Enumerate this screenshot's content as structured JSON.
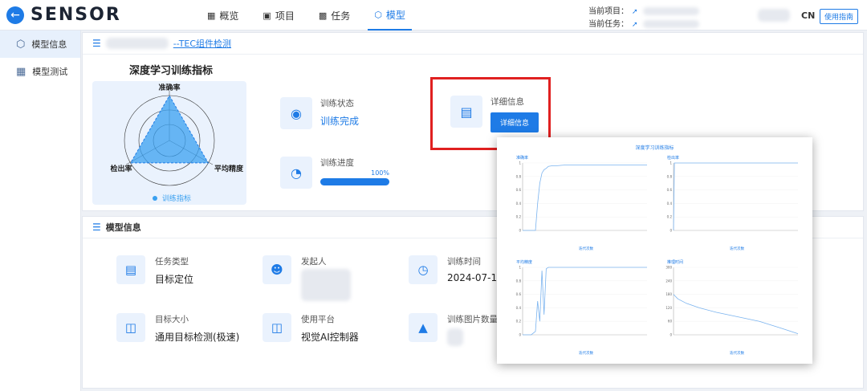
{
  "topbar": {
    "logo": "SENSOR",
    "nav": [
      {
        "label": "概览",
        "icon": "grid-icon"
      },
      {
        "label": "项目",
        "icon": "folder-icon"
      },
      {
        "label": "任务",
        "icon": "image-icon"
      },
      {
        "label": "模型",
        "icon": "cube-icon",
        "active": true
      }
    ],
    "current_project_label": "当前项目：",
    "current_task_label": "当前任务：",
    "lang": "CN",
    "guide_label": "使用指南"
  },
  "sidebar": {
    "items": [
      {
        "label": "模型信息",
        "icon": "cube-icon",
        "active": true
      },
      {
        "label": "模型测试",
        "icon": "grid-icon"
      }
    ]
  },
  "model_header": {
    "title_suffix": "--TEC组件检测"
  },
  "radar": {
    "title": "深度学习训练指标",
    "axes": [
      "准确率",
      "平均精度",
      "检出率"
    ],
    "legend": "训练指标",
    "values": [
      0.9,
      0.9,
      0.9
    ]
  },
  "training": {
    "status_label": "训练状态",
    "status_value": "训练完成",
    "progress_label": "训练进度",
    "progress_value": 1.0,
    "progress_text": "100%"
  },
  "detail": {
    "label": "详细信息",
    "button": "详细信息"
  },
  "model_info": {
    "header": "模型信息",
    "items": [
      {
        "label": "任务类型",
        "value": "目标定位",
        "icon": "doc-icon"
      },
      {
        "label": "发起人",
        "value": "",
        "icon": "user-icon"
      },
      {
        "label": "训练时间",
        "value": "2024-07-10 1",
        "icon": "clock-icon"
      },
      {
        "label": "目标大小",
        "value": "通用目标检测(极速)",
        "icon": "layout-icon"
      },
      {
        "label": "使用平台",
        "value": "视觉AI控制器",
        "icon": "layout-icon"
      },
      {
        "label": "训练图片数量",
        "value": "",
        "icon": "pyramid-icon"
      }
    ]
  },
  "popup": {
    "title": "深度学习训练指标",
    "xlabel": "迭代次数"
  },
  "chart_data": [
    {
      "type": "line",
      "title": "准确率",
      "xlabel": "迭代次数",
      "ylim": [
        0,
        1
      ],
      "x": [
        0,
        10,
        20,
        30,
        35,
        40,
        45,
        50,
        55,
        60,
        70,
        80,
        100,
        150,
        200,
        290
      ],
      "y": [
        0,
        0,
        0,
        0,
        0.4,
        0.7,
        0.85,
        0.9,
        0.92,
        0.95,
        0.96,
        0.96,
        0.97,
        0.97,
        0.97,
        0.97
      ]
    },
    {
      "type": "line",
      "title": "检出率",
      "xlabel": "迭代次数",
      "ylim": [
        0,
        1
      ],
      "x": [
        0,
        2,
        290
      ],
      "y": [
        0,
        1,
        1
      ]
    },
    {
      "type": "line",
      "title": "平均精度",
      "xlabel": "迭代次数",
      "ylim": [
        0,
        1
      ],
      "x": [
        0,
        10,
        20,
        30,
        35,
        40,
        45,
        50,
        55,
        60,
        100,
        200,
        290
      ],
      "y": [
        0,
        0,
        0,
        0.05,
        0.5,
        0.2,
        0.95,
        0.3,
        0.98,
        1,
        1,
        1,
        1
      ]
    },
    {
      "type": "line",
      "title": "推理时间",
      "xlabel": "迭代次数",
      "ylim": [
        0,
        300
      ],
      "x": [
        0,
        10,
        30,
        60,
        100,
        150,
        200,
        250,
        290
      ],
      "y": [
        180,
        160,
        140,
        120,
        100,
        80,
        60,
        30,
        5
      ]
    }
  ]
}
